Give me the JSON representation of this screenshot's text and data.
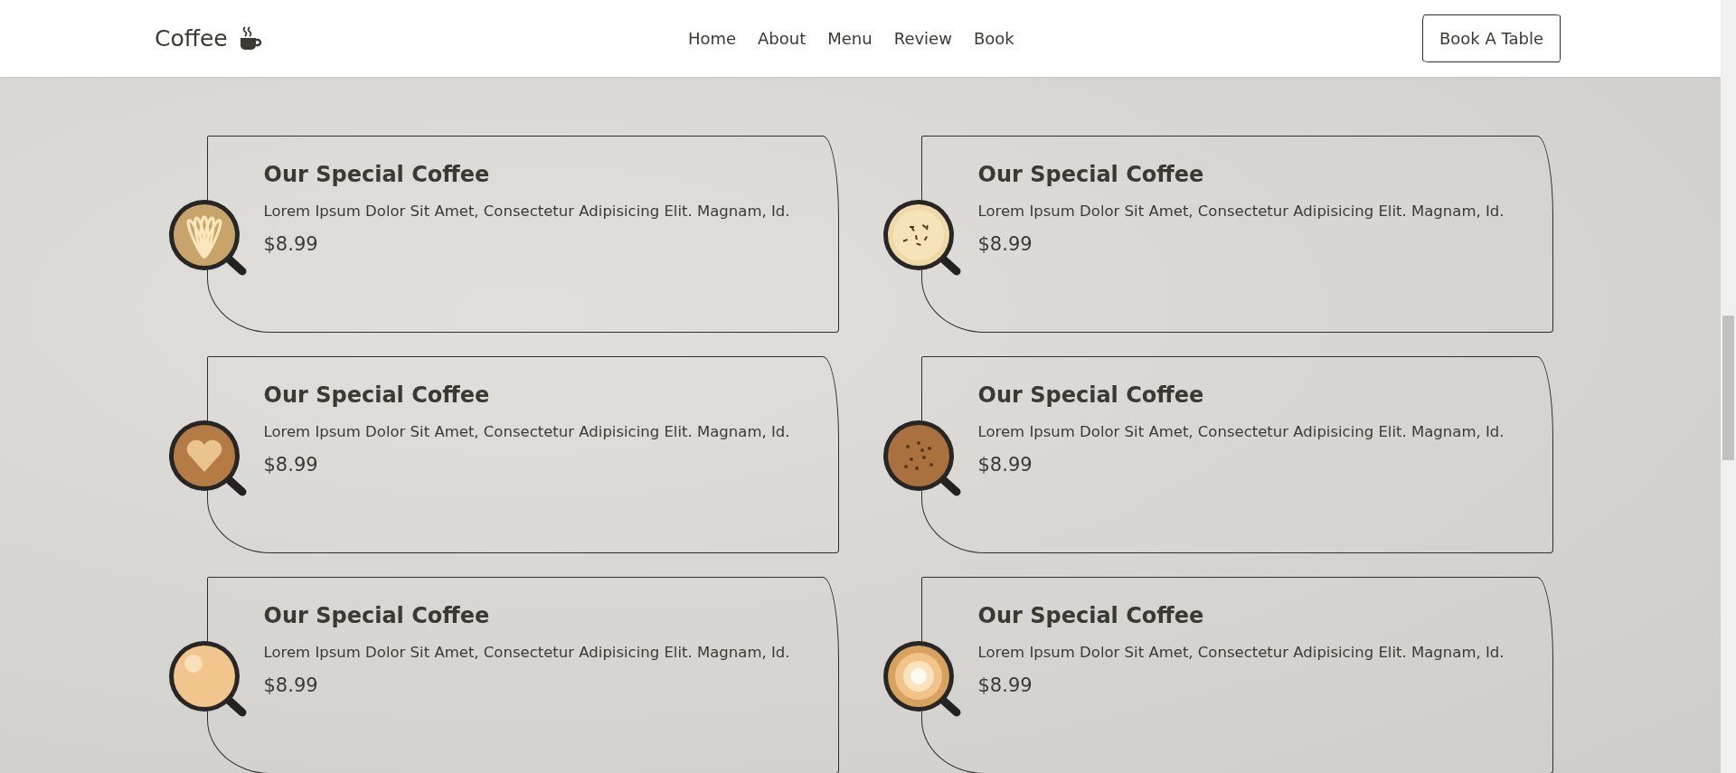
{
  "header": {
    "logo": "Coffee",
    "nav": [
      {
        "label": "Home"
      },
      {
        "label": "About"
      },
      {
        "label": "Menu"
      },
      {
        "label": "Review"
      },
      {
        "label": "Book"
      }
    ],
    "cta": "Book A Table"
  },
  "section": {
    "items": [
      {
        "title": "Our Special Coffee",
        "description": "Lorem Ipsum Dolor Sit Amet, Consectetur Adipisicing Elit. Magnam, Id.",
        "price": "$8.99"
      },
      {
        "title": "Our Special Coffee",
        "description": "Lorem Ipsum Dolor Sit Amet, Consectetur Adipisicing Elit. Magnam, Id.",
        "price": "$8.99"
      },
      {
        "title": "Our Special Coffee",
        "description": "Lorem Ipsum Dolor Sit Amet, Consectetur Adipisicing Elit. Magnam, Id.",
        "price": "$8.99"
      },
      {
        "title": "Our Special Coffee",
        "description": "Lorem Ipsum Dolor Sit Amet, Consectetur Adipisicing Elit. Magnam, Id.",
        "price": "$8.99"
      },
      {
        "title": "Our Special Coffee",
        "description": "Lorem Ipsum Dolor Sit Amet, Consectetur Adipisicing Elit. Magnam, Id.",
        "price": "$8.99"
      },
      {
        "title": "Our Special Coffee",
        "description": "Lorem Ipsum Dolor Sit Amet, Consectetur Adipisicing Elit. Magnam, Id.",
        "price": "$8.99"
      }
    ]
  }
}
